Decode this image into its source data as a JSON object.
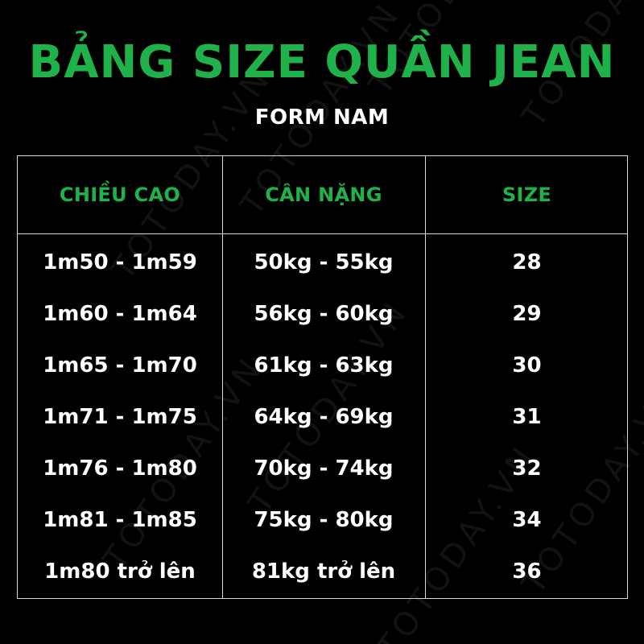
{
  "watermark": "TOTODAY.VN",
  "title": "BẢNG SIZE QUẦN JEAN",
  "subtitle": "FORM NAM",
  "colors": {
    "background": "#000000",
    "accent": "#1fb24a",
    "text": "#ffffff",
    "border": "#d9d9d9"
  },
  "table": {
    "headers": [
      "CHIỀU CAO",
      "CÂN NẶNG",
      "SIZE"
    ],
    "rows": [
      [
        "1m50 - 1m59",
        "50kg - 55kg",
        "28"
      ],
      [
        "1m60 - 1m64",
        "56kg - 60kg",
        "29"
      ],
      [
        "1m65 - 1m70",
        "61kg - 63kg",
        "30"
      ],
      [
        "1m71 - 1m75",
        "64kg - 69kg",
        "31"
      ],
      [
        "1m76 - 1m80",
        "70kg - 74kg",
        "32"
      ],
      [
        "1m81 - 1m85",
        "75kg - 80kg",
        "34"
      ],
      [
        "1m80 trở lên",
        "81kg trở lên",
        "36"
      ]
    ]
  }
}
